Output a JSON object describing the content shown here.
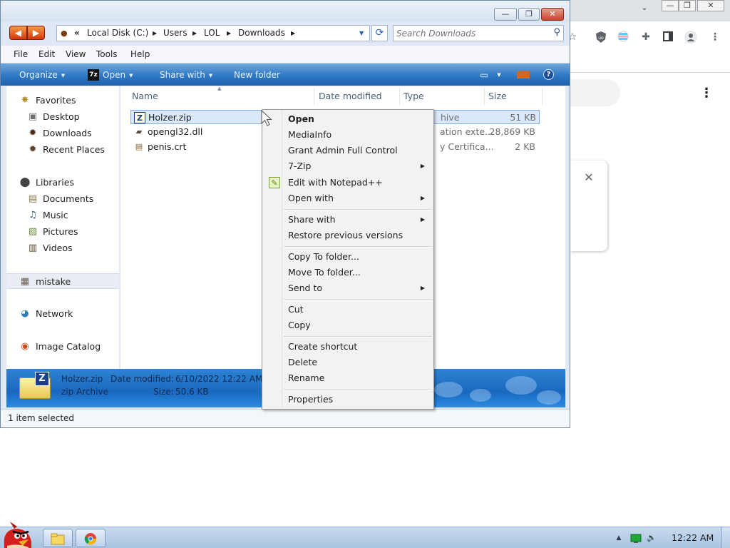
{
  "browser": {
    "window_controls": [
      "⌄",
      "—",
      "❐",
      "✕"
    ],
    "extensions": [
      "bookmark-star-icon",
      "ublock-icon",
      "flag-icon",
      "puzzle-icon",
      "sidepanel-icon",
      "profile-icon",
      "kebab-icon"
    ],
    "kebab": "⋮",
    "dialog_close": "✕"
  },
  "explorer": {
    "title_controls": {
      "minimize": "—",
      "maximize": "❐",
      "close": "✕"
    },
    "breadcrumb": [
      "«",
      "Local Disk (C:)",
      "Users",
      "LOL",
      "Downloads"
    ],
    "search_placeholder": "Search Downloads",
    "menu": [
      "File",
      "Edit",
      "View",
      "Tools",
      "Help"
    ],
    "commands": {
      "organize": "Organize",
      "open": "Open",
      "open_icon_text": "7z",
      "share": "Share with",
      "new_folder": "New folder"
    },
    "nav_pane": {
      "favorites": "Favorites",
      "desktop": "Desktop",
      "downloads": "Downloads",
      "recent": "Recent Places",
      "libraries": "Libraries",
      "documents": "Documents",
      "music": "Music",
      "pictures": "Pictures",
      "videos": "Videos",
      "mistake": "mistake",
      "network": "Network",
      "image_catalog": "Image Catalog"
    },
    "columns": {
      "name": "Name",
      "date": "Date modified",
      "type": "Type",
      "size": "Size"
    },
    "files": [
      {
        "name": "Holzer.zip",
        "type": "hive",
        "size": "51 KB",
        "icon": "zip-icon"
      },
      {
        "name": "opengl32.dll",
        "type": "ation exte...",
        "size": "28,869 KB",
        "icon": "dll-icon"
      },
      {
        "name": "penis.crt",
        "type": "y Certifica...",
        "size": "2 KB",
        "icon": "certificate-icon"
      }
    ],
    "details": {
      "badge": "Z",
      "filename": "Holzer.zip",
      "filetype": "zip Archive",
      "date_label": "Date modified:",
      "date_value": "6/10/2022 12:22 AM",
      "size_label": "Size:",
      "size_value": "50.6 KB"
    },
    "status": "1 item selected"
  },
  "context_menu": {
    "open": "Open",
    "mediainfo": "MediaInfo",
    "grant_admin": "Grant Admin Full Control",
    "sevenzip": "7-Zip",
    "edit_notepad": "Edit with Notepad++",
    "open_with": "Open with",
    "share_with": "Share with",
    "restore": "Restore previous versions",
    "copy_to": "Copy To folder...",
    "move_to": "Move To folder...",
    "send_to": "Send to",
    "cut": "Cut",
    "copy": "Copy",
    "create_shortcut": "Create shortcut",
    "delete": "Delete",
    "rename": "Rename",
    "properties": "Properties"
  },
  "taskbar": {
    "clock": "12:22 AM",
    "tray": [
      "show-hidden-icons",
      "network-icon",
      "volume-icon"
    ]
  }
}
